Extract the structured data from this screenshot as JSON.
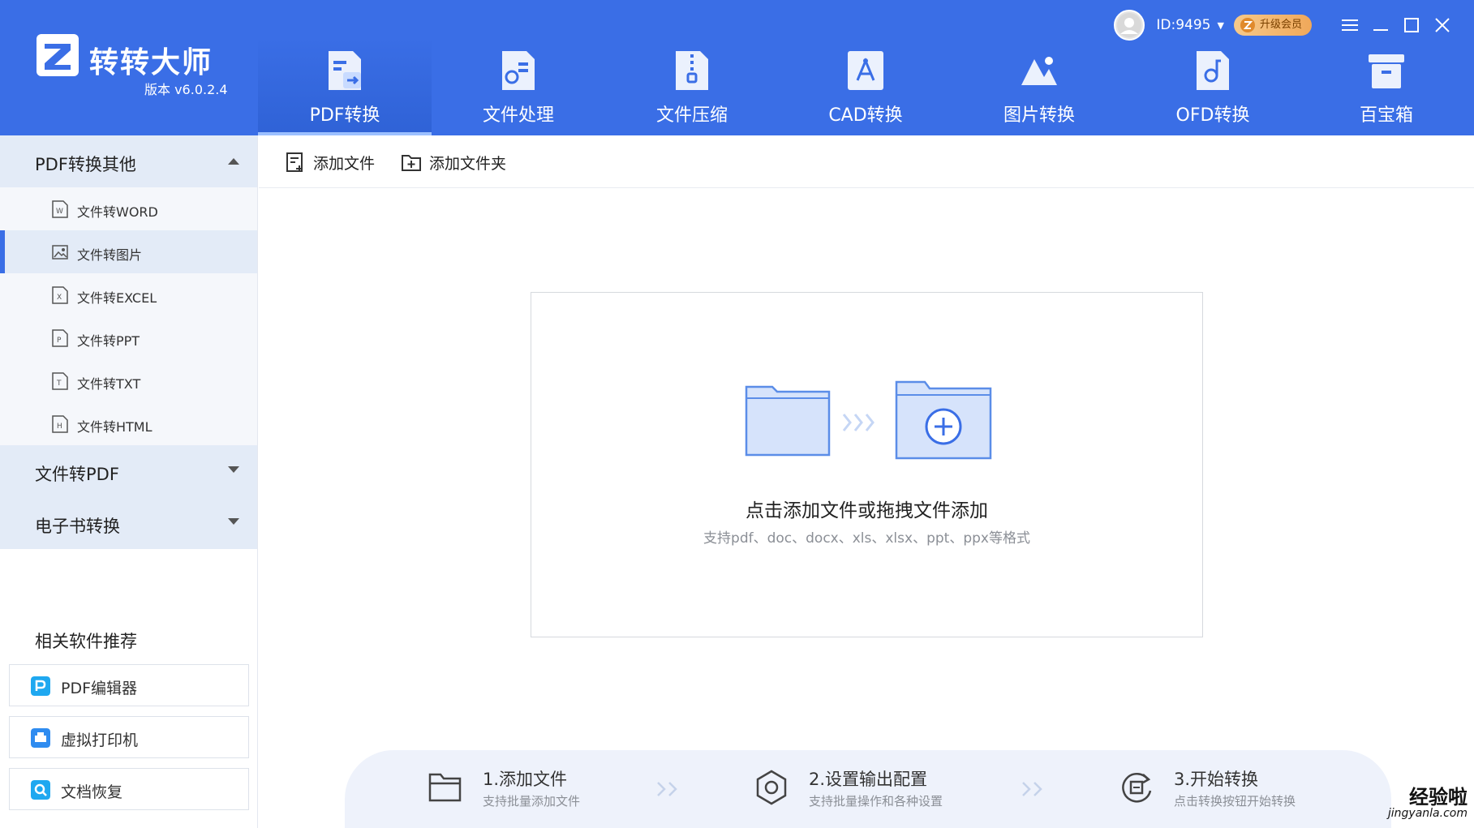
{
  "app": {
    "brand": "转转大师",
    "version": "版本 v6.0.2.4"
  },
  "nav": {
    "tabs": [
      {
        "label": "PDF转换",
        "icon": "pdf-convert-icon",
        "active": true
      },
      {
        "label": "文件处理",
        "icon": "file-process-icon",
        "active": false
      },
      {
        "label": "文件压缩",
        "icon": "file-compress-icon",
        "active": false
      },
      {
        "label": "CAD转换",
        "icon": "cad-convert-icon",
        "active": false
      },
      {
        "label": "图片转换",
        "icon": "image-convert-icon",
        "active": false
      },
      {
        "label": "OFD转换",
        "icon": "ofd-convert-icon",
        "active": false
      },
      {
        "label": "百宝箱",
        "icon": "toolbox-icon",
        "active": false
      }
    ]
  },
  "user": {
    "id": "ID:9495",
    "vip_label": "升级会员"
  },
  "sidebar": {
    "groups": [
      {
        "title": "PDF转换其他",
        "expanded": true,
        "items": [
          {
            "label": "文件转WORD",
            "icon": "word-file-icon",
            "active": false
          },
          {
            "label": "文件转图片",
            "icon": "image-file-icon",
            "active": true
          },
          {
            "label": "文件转EXCEL",
            "icon": "excel-file-icon",
            "active": false
          },
          {
            "label": "文件转PPT",
            "icon": "ppt-file-icon",
            "active": false
          },
          {
            "label": "文件转TXT",
            "icon": "txt-file-icon",
            "active": false
          },
          {
            "label": "文件转HTML",
            "icon": "html-file-icon",
            "active": false
          }
        ]
      },
      {
        "title": "文件转PDF",
        "expanded": false
      },
      {
        "title": "电子书转换",
        "expanded": false
      }
    ],
    "recommend_title": "相关软件推荐",
    "recommend": [
      {
        "label": "PDF编辑器",
        "icon": "pdf-editor-icon"
      },
      {
        "label": "虚拟打印机",
        "icon": "virtual-printer-icon"
      },
      {
        "label": "文档恢复",
        "icon": "doc-recovery-icon"
      }
    ]
  },
  "toolbar": {
    "add_file": "添加文件",
    "add_folder": "添加文件夹"
  },
  "dropzone": {
    "title": "点击添加文件或拖拽文件添加",
    "subtitle": "支持pdf、doc、docx、xls、xlsx、ppt、ppx等格式"
  },
  "steps": [
    {
      "title": "1.添加文件",
      "desc": "支持批量添加文件",
      "icon": "folder-icon"
    },
    {
      "title": "2.设置输出配置",
      "desc": "支持批量操作和各种设置",
      "icon": "settings-icon"
    },
    {
      "title": "3.开始转换",
      "desc": "点击转换按钮开始转换",
      "icon": "convert-icon"
    }
  ],
  "watermark": {
    "text": "经验啦",
    "url": "jingyanla.com"
  },
  "colors": {
    "header_bg": "#3a6ee6",
    "sidebar_active": "#e3ebf7",
    "accent": "#3a6ee6"
  }
}
